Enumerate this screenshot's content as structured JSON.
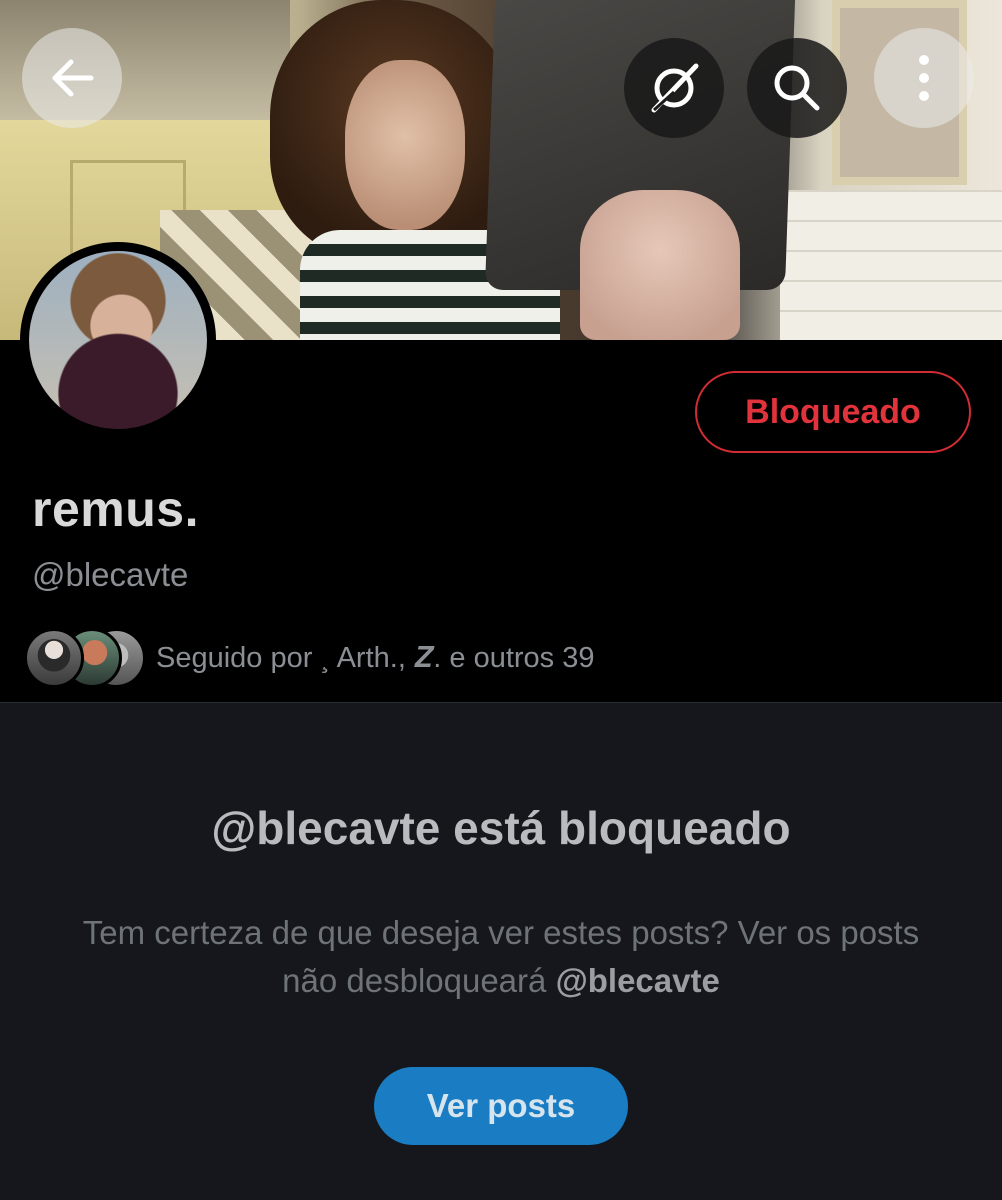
{
  "header": {
    "back_icon": "arrow-left-icon",
    "grok_icon": "grok-slash-icon",
    "search_icon": "search-icon",
    "more_icon": "more-vertical-icon"
  },
  "profile": {
    "display_name": "remus.",
    "handle": "@blecavte",
    "blocked_label": "Bloqueado",
    "followed_by_text": "Seguido por ¸ Arth., 𝒁. e outros 39",
    "colors": {
      "blocked_accent": "#e0333b",
      "primary_button": "#1a7dc4"
    }
  },
  "blocked_notice": {
    "title": "@blecavte está bloqueado",
    "description_start": "Tem certeza de que deseja ver estes posts? Ver os posts não desbloqueará ",
    "description_handle": "@blecavte",
    "view_posts_label": "Ver posts"
  }
}
